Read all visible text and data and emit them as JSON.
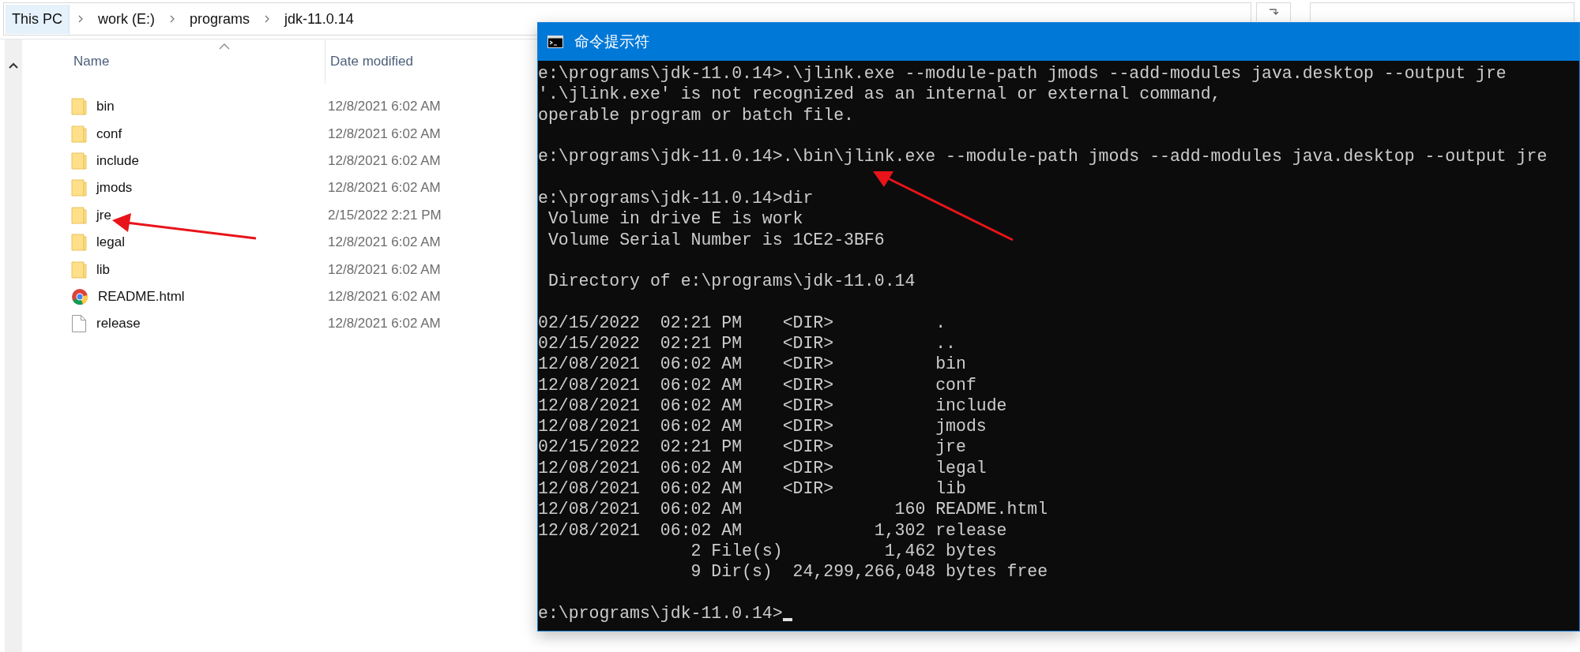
{
  "explorer": {
    "breadcrumb": [
      {
        "label": "This PC",
        "selected": true
      },
      {
        "label": "work (E:)",
        "selected": false
      },
      {
        "label": "programs",
        "selected": false
      },
      {
        "label": "jdk-11.0.14",
        "selected": false
      }
    ],
    "columns": [
      "Name",
      "Date modified"
    ],
    "files": [
      {
        "name": "bin",
        "kind": "folder",
        "date": "12/8/2021 6:02 AM"
      },
      {
        "name": "conf",
        "kind": "folder",
        "date": "12/8/2021 6:02 AM"
      },
      {
        "name": "include",
        "kind": "folder",
        "date": "12/8/2021 6:02 AM"
      },
      {
        "name": "jmods",
        "kind": "folder",
        "date": "12/8/2021 6:02 AM"
      },
      {
        "name": "jre",
        "kind": "folder",
        "date": "2/15/2022 2:21 PM"
      },
      {
        "name": "legal",
        "kind": "folder",
        "date": "12/8/2021 6:02 AM"
      },
      {
        "name": "lib",
        "kind": "folder",
        "date": "12/8/2021 6:02 AM"
      },
      {
        "name": "README.html",
        "kind": "web",
        "date": "12/8/2021 6:02 AM"
      },
      {
        "name": "release",
        "kind": "file",
        "date": "12/8/2021 6:02 AM"
      }
    ]
  },
  "console": {
    "title": "命令提示符",
    "cursor": true,
    "blocks": [
      [
        "e:\\programs\\jdk-11.0.14>.\\jlink.exe --module-path jmods --add-modules java.desktop --output jre",
        "'.\\jlink.exe' is not recognized as an internal or external command,",
        "operable program or batch file."
      ],
      [
        "e:\\programs\\jdk-11.0.14>.\\bin\\jlink.exe --module-path jmods --add-modules java.desktop --output jre"
      ],
      [
        "e:\\programs\\jdk-11.0.14>dir",
        " Volume in drive E is work",
        " Volume Serial Number is 1CE2-3BF6"
      ],
      [
        " Directory of e:\\programs\\jdk-11.0.14"
      ],
      [
        "02/15/2022  02:21 PM    <DIR>          .",
        "02/15/2022  02:21 PM    <DIR>          ..",
        "12/08/2021  06:02 AM    <DIR>          bin",
        "12/08/2021  06:02 AM    <DIR>          conf",
        "12/08/2021  06:02 AM    <DIR>          include",
        "12/08/2021  06:02 AM    <DIR>          jmods",
        "02/15/2022  02:21 PM    <DIR>          jre",
        "12/08/2021  06:02 AM    <DIR>          legal",
        "12/08/2021  06:02 AM    <DIR>          lib",
        "12/08/2021  06:02 AM               160 README.html",
        "12/08/2021  06:02 AM             1,302 release",
        "               2 File(s)          1,462 bytes",
        "               9 Dir(s)  24,299,266,048 bytes free"
      ],
      [
        "e:\\programs\\jdk-11.0.14>"
      ]
    ]
  }
}
